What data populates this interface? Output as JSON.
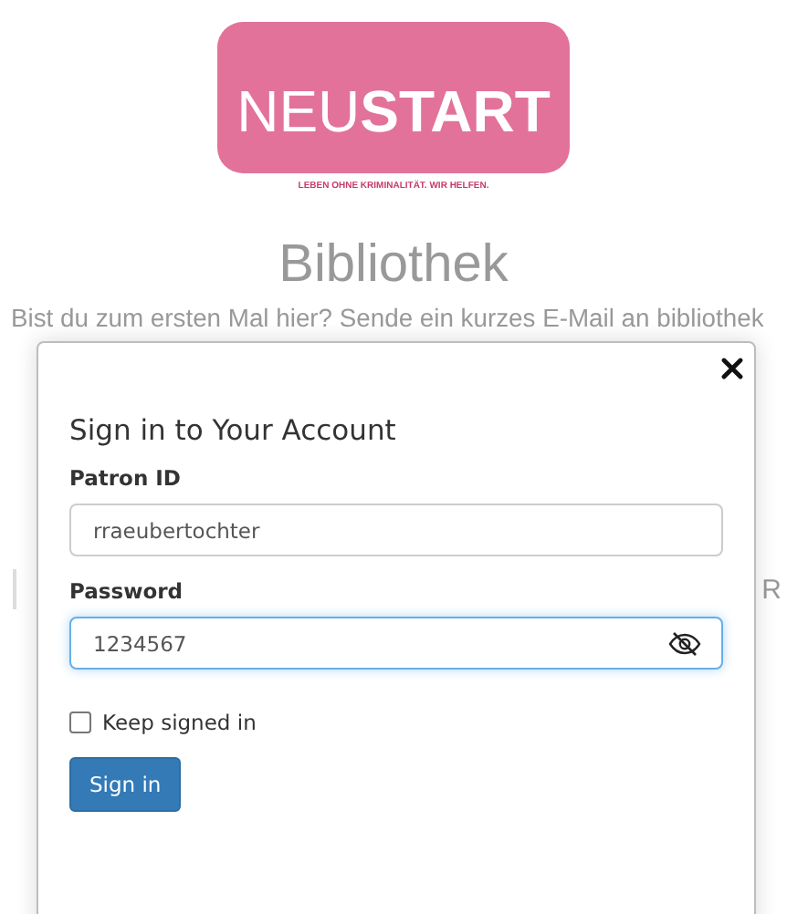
{
  "logo": {
    "light_part": "NEU",
    "bold_part": "START",
    "tagline": "LEBEN OHNE KRIMINALITÄT. WIR HELFEN."
  },
  "heading": "Bibliothek",
  "intro": "Bist du zum ersten Mal hier? Sende ein kurzes E-Mail an bibliothek",
  "side_fragment": "R",
  "modal": {
    "title": "Sign in to Your Account",
    "fields": [
      {
        "label": "Patron ID",
        "value": "rraeubertochter",
        "kind": "text",
        "focused": false
      },
      {
        "label": "Password",
        "value": "1234567",
        "kind": "password",
        "focused": true
      }
    ],
    "keep_signed_in": {
      "label": "Keep signed in",
      "checked": false
    },
    "submit": "Sign in"
  }
}
